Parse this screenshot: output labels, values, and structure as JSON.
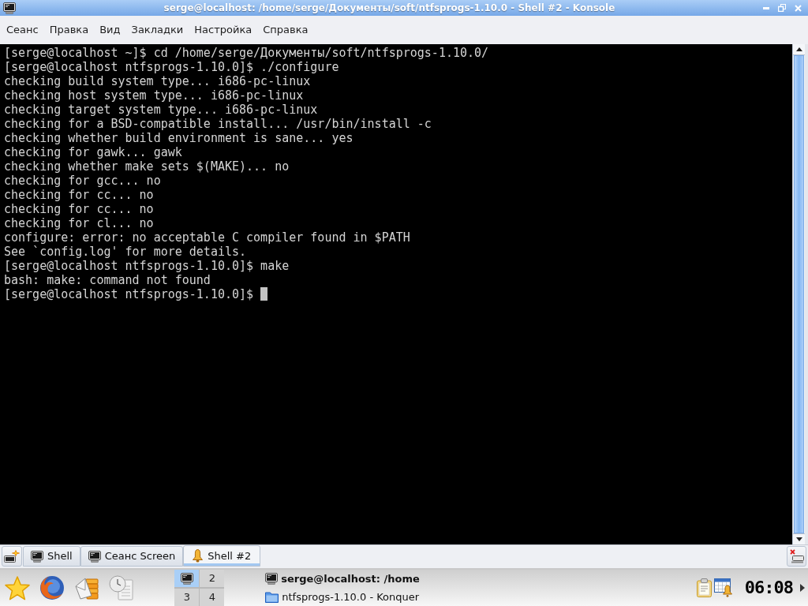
{
  "window": {
    "title": "serge@localhost: /home/serge/Документы/soft/ntfsprogs-1.10.0 - Shell #2 - Konsole"
  },
  "menu": [
    "Сеанс",
    "Правка",
    "Вид",
    "Закладки",
    "Настройка",
    "Справка"
  ],
  "terminal": {
    "lines": [
      "[serge@localhost ~]$ cd /home/serge/Документы/soft/ntfsprogs-1.10.0/",
      "[serge@localhost ntfsprogs-1.10.0]$ ./configure",
      "checking build system type... i686-pc-linux",
      "checking host system type... i686-pc-linux",
      "checking target system type... i686-pc-linux",
      "checking for a BSD-compatible install... /usr/bin/install -c",
      "checking whether build environment is sane... yes",
      "checking for gawk... gawk",
      "checking whether make sets $(MAKE)... no",
      "checking for gcc... no",
      "checking for cc... no",
      "checking for cc... no",
      "checking for cl... no",
      "configure: error: no acceptable C compiler found in $PATH",
      "See `config.log' for more details.",
      "[serge@localhost ntfsprogs-1.10.0]$ make",
      "bash: make: command not found",
      "[serge@localhost ntfsprogs-1.10.0]$"
    ],
    "cursor": true
  },
  "tabs": [
    {
      "label": "Shell",
      "selected": false,
      "bell": false
    },
    {
      "label": "Сеанс Screen",
      "selected": false,
      "bell": false
    },
    {
      "label": "Shell #2",
      "selected": true,
      "bell": true
    }
  ],
  "taskbar": {
    "desktops": [
      {
        "kind": "preview",
        "selected": true
      },
      {
        "kind": "number",
        "label": "2",
        "selected": false
      },
      {
        "kind": "number",
        "label": "3",
        "selected": false
      },
      {
        "kind": "number",
        "label": "4",
        "selected": false
      }
    ],
    "tasks": [
      {
        "kind": "terminal",
        "label": "serge@localhost: /home",
        "selected": true
      },
      {
        "kind": "folder",
        "label": "ntfsprogs-1.10.0 - Konquer",
        "selected": false
      }
    ],
    "clock": "06:08"
  }
}
